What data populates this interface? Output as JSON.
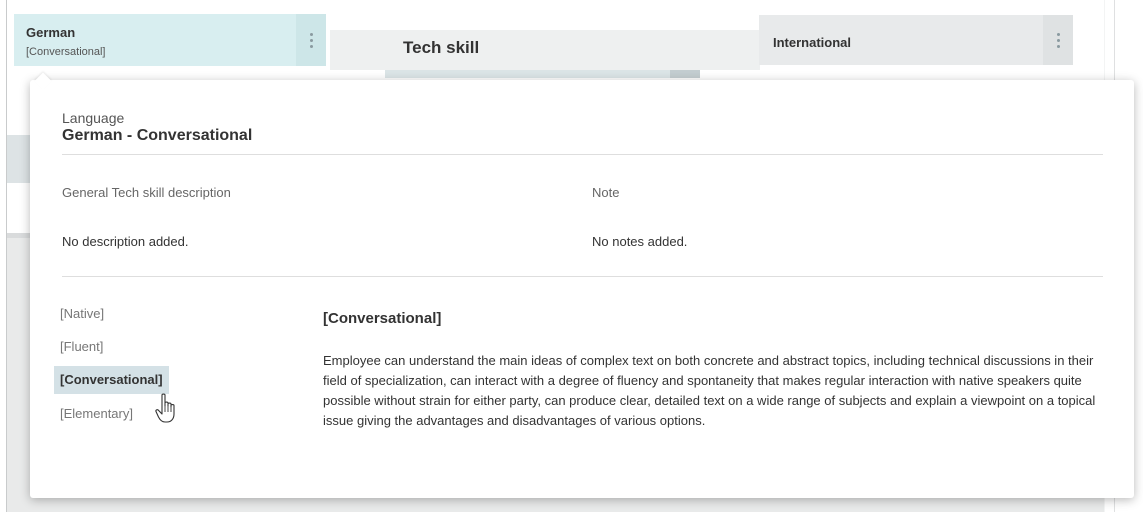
{
  "cards": {
    "german": {
      "title": "German",
      "subtitle": "[Conversational]"
    },
    "tech_skill": {
      "title": "Tech skill"
    },
    "international": {
      "title": "International"
    }
  },
  "panel": {
    "language_label": "Language",
    "language_value": "German - Conversational",
    "description_label": "General Tech skill description",
    "description_value": "No description added.",
    "note_label": "Note",
    "note_value": "No notes added.",
    "levels": [
      {
        "label": "[Native]",
        "selected": false
      },
      {
        "label": "[Fluent]",
        "selected": false
      },
      {
        "label": "[Conversational]",
        "selected": true
      },
      {
        "label": "[Elementary]",
        "selected": false
      }
    ],
    "detail": {
      "title": "[Conversational]",
      "text": "Employee can understand the main ideas of complex text on both concrete and abstract topics, including technical discussions in their field of specialization, can interact with a degree of fluency and spontaneity that makes regular interaction with native speakers quite possible without strain for either party, can produce clear, detailed text on a wide range of subjects and explain a viewpoint on a topical issue giving the advantages and disadvantages of various options."
    }
  },
  "icons": {
    "card_menu": "vertical-dots-icon",
    "cursor": "hand-pointer-icon"
  },
  "colors": {
    "selected_card_bg": "#d8eef0",
    "selected_level_bg": "#d4e1e6"
  }
}
